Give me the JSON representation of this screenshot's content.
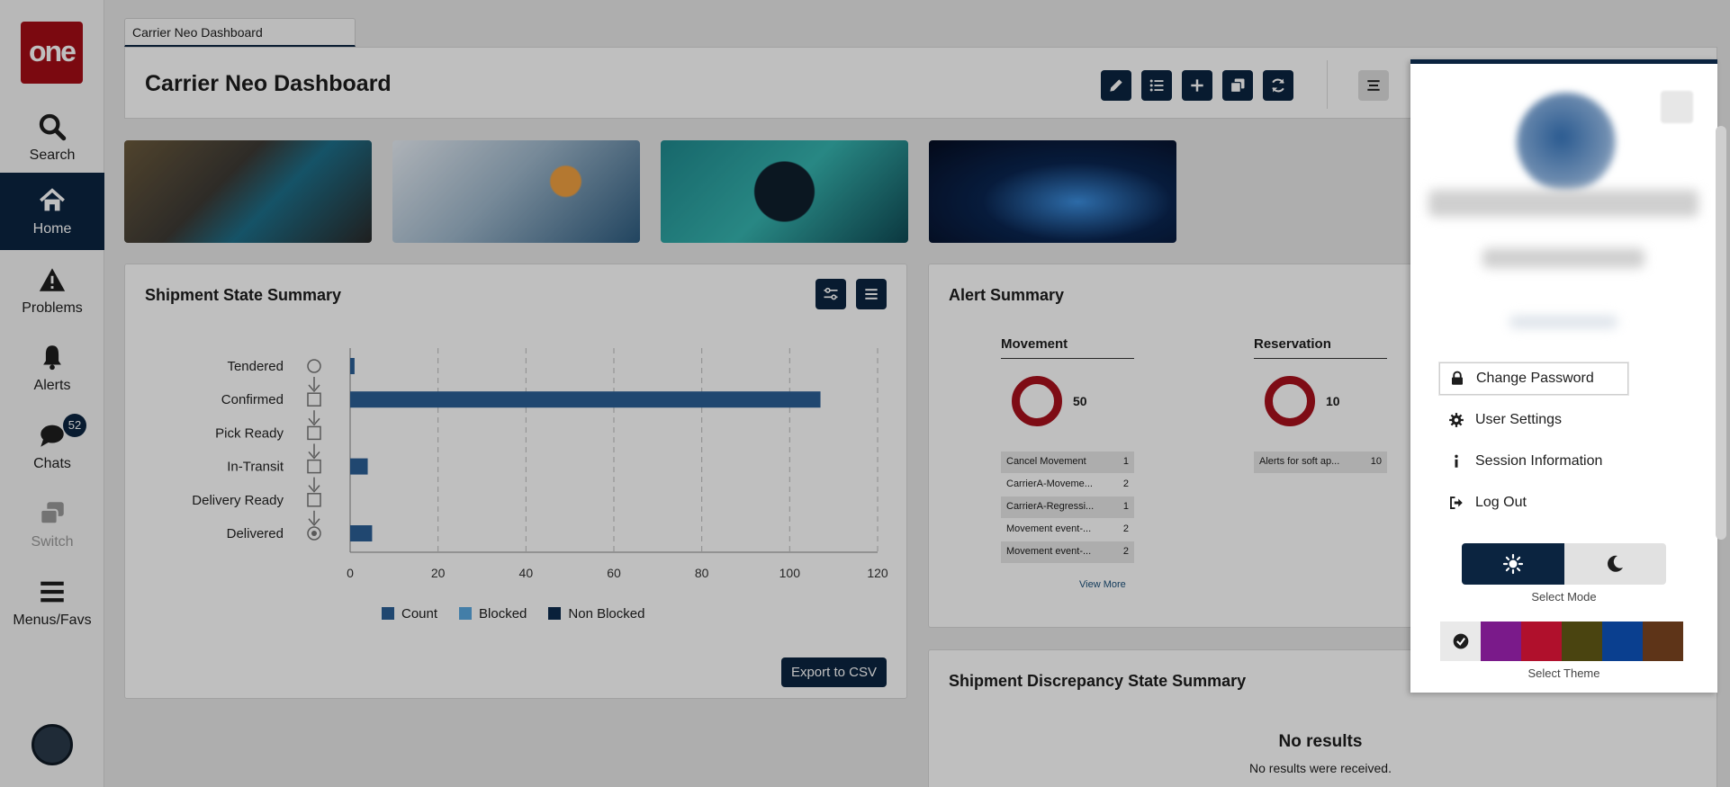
{
  "app": {
    "logo_text": "one",
    "tab_label": "Carrier Neo Dashboard",
    "page_title": "Carrier Neo Dashboard"
  },
  "nav": {
    "items": [
      {
        "label": "Search",
        "icon": "search-icon"
      },
      {
        "label": "Home",
        "icon": "home-icon"
      },
      {
        "label": "Problems",
        "icon": "warning-icon"
      },
      {
        "label": "Alerts",
        "icon": "bell-icon"
      },
      {
        "label": "Chats",
        "icon": "chat-icon"
      },
      {
        "label": "Switch",
        "icon": "switch-icon"
      },
      {
        "label": "Menus/Favs",
        "icon": "hamburger-icon"
      }
    ],
    "chat_badge": "52"
  },
  "shipment_state": {
    "title": "Shipment State Summary",
    "export_label": "Export to CSV",
    "legend": [
      {
        "name": "Count",
        "color": "#2b5f96"
      },
      {
        "name": "Blocked",
        "color": "#5aa9e0"
      },
      {
        "name": "Non Blocked",
        "color": "#0d2b4e"
      }
    ]
  },
  "chart_data": {
    "type": "bar",
    "orientation": "horizontal",
    "categories": [
      "Tendered",
      "Confirmed",
      "Pick Ready",
      "In-Transit",
      "Delivery Ready",
      "Delivered"
    ],
    "series": [
      {
        "name": "Count",
        "values": [
          1,
          107,
          0,
          4,
          0,
          5
        ]
      }
    ],
    "xlim": [
      0,
      120
    ],
    "xticks": [
      0,
      20,
      40,
      60,
      80,
      100,
      120
    ],
    "grid": true,
    "legend": "bottom"
  },
  "alert_summary": {
    "title": "Alert Summary",
    "columns": [
      {
        "header": "Movement",
        "total": "50",
        "rows": [
          {
            "label": "Cancel Movement",
            "value": "1"
          },
          {
            "label": "CarrierA-Moveme...",
            "value": "2"
          },
          {
            "label": "CarrierA-Regressi...",
            "value": "1"
          },
          {
            "label": "Movement event-...",
            "value": "2"
          },
          {
            "label": "Movement event-...",
            "value": "2"
          }
        ],
        "view_more": "View More"
      },
      {
        "header": "Reservation",
        "total": "10",
        "rows": [
          {
            "label": "Alerts for soft ap...",
            "value": "10"
          }
        ]
      }
    ]
  },
  "discrepancy": {
    "title": "Shipment Discrepancy State Summary",
    "no_results_title": "No results",
    "no_results_text": "No results were received."
  },
  "profile_menu": {
    "items": [
      {
        "label": "Change Password",
        "icon": "lock-icon"
      },
      {
        "label": "User Settings",
        "icon": "gear-icon"
      },
      {
        "label": "Session Information",
        "icon": "info-icon"
      },
      {
        "label": "Log Out",
        "icon": "logout-icon"
      }
    ],
    "select_mode_label": "Select Mode",
    "select_theme_label": "Select Theme",
    "themes": [
      "#e9e9e9",
      "#7a1a8a",
      "#b0102c",
      "#4a4410",
      "#0a3f8f",
      "#5e3418"
    ]
  }
}
